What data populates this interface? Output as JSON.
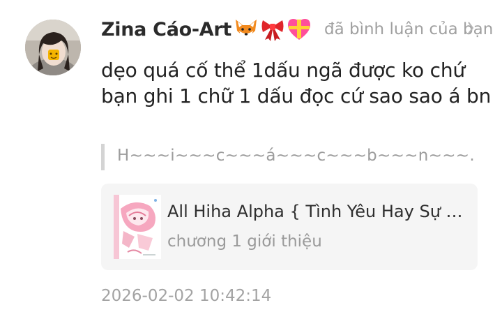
{
  "comment": {
    "username": "Zina Cáo-Art",
    "emojis": [
      "fox-emoji",
      "ribbon-emoji",
      "heart-gift-emoji"
    ],
    "action": "đã bình luận của bạn",
    "body": "dẹo quá cố thể 1dấu ngã được ko chứ bạn ghi 1 chữ 1 dấu đọc cứ sao sao á bn",
    "quote": "H~~~i~~~c~~~á~~~c~~~b~~~n~~~.",
    "timestamp": "2026-02-02 10:42:14"
  },
  "story": {
    "title": "All Hiha Alpha { Tình Yêu Hay Sự …",
    "chapter": "chương 1 giới thiệu",
    "cover_icon": "story-cover-image"
  },
  "colors": {
    "username": "#2b2b2b",
    "muted": "#a0a0a0",
    "card_bg": "#f5f5f5",
    "quote_bar": "#d4d4d4"
  }
}
